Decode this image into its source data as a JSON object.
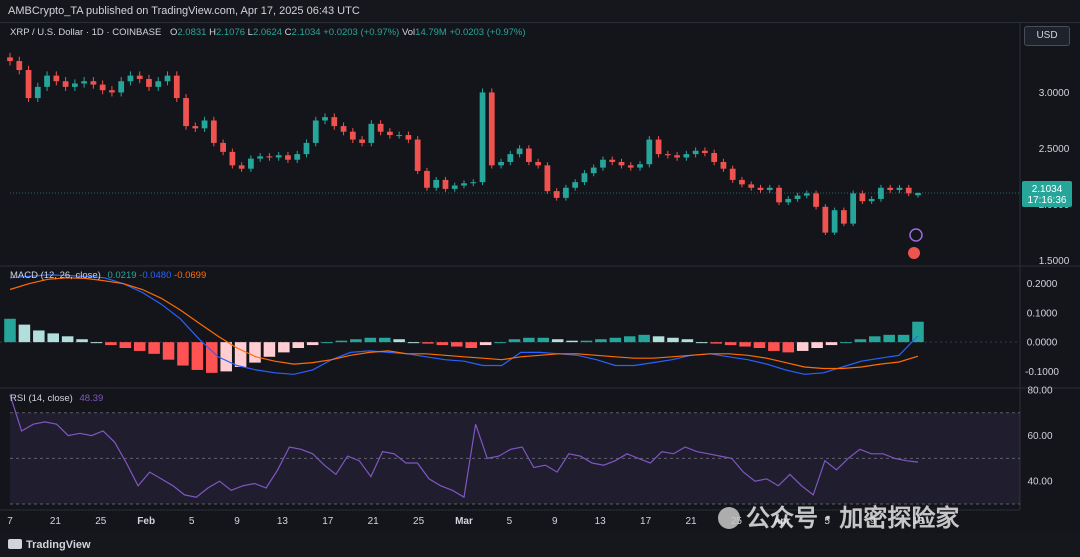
{
  "header": {
    "published": "AMBCrypto_TA published on TradingView.com, Apr 17, 2025 06:43 UTC",
    "currency_button": "USD"
  },
  "legend": {
    "symbol": "XRP / U.S. Dollar · 1D · COINBASE",
    "open_label": "O",
    "open": "2.0831",
    "high_label": "H",
    "high": "2.1076",
    "low_label": "L",
    "low": "2.0624",
    "close_label": "C",
    "close": "2.1034",
    "change": "+0.0203 (+0.97%)",
    "vol_label": "Vol",
    "vol": "14.79M",
    "vol_change": "+0.0203 (+0.97%)"
  },
  "macd_legend": {
    "label": "MACD (12, 26, close)",
    "macd": "0.0219",
    "signal": "-0.0480",
    "hist": "-0.0699"
  },
  "rsi_legend": {
    "label": "RSI (14, close)",
    "value": "48.39"
  },
  "price_tag": {
    "price": "2.1034",
    "countdown": "17:16:36"
  },
  "footer": {
    "brand": "TradingView"
  },
  "watermark": "公众号 · 加密探险家",
  "colors": {
    "up": "#26a69a",
    "down": "#ef5350",
    "macd": "#2962ff",
    "signal": "#ff6d00",
    "rsi": "#7e57c2",
    "bg": "#14151a"
  },
  "chart_data": [
    {
      "type": "candlestick",
      "title": "XRP / U.S. Dollar · 1D · COINBASE",
      "x_ticks": [
        "7",
        "21",
        "25",
        "Feb",
        "5",
        "9",
        "13",
        "17",
        "21",
        "25",
        "Mar",
        "5",
        "9",
        "13",
        "17",
        "21",
        "25",
        "Apr",
        "5",
        "9",
        "13"
      ],
      "y_ticks": [
        "3.0000",
        "2.5000",
        "2.0000",
        "1.5000"
      ],
      "ylim": [
        1.47,
        3.45
      ],
      "close_series": [
        3.28,
        3.2,
        2.95,
        3.05,
        3.15,
        3.1,
        3.05,
        3.08,
        3.1,
        3.07,
        3.02,
        3.0,
        3.1,
        3.15,
        3.12,
        3.05,
        3.1,
        3.15,
        2.95,
        2.7,
        2.68,
        2.75,
        2.55,
        2.47,
        2.35,
        2.32,
        2.41,
        2.43,
        2.42,
        2.44,
        2.4,
        2.45,
        2.55,
        2.75,
        2.78,
        2.7,
        2.65,
        2.58,
        2.55,
        2.72,
        2.65,
        2.62,
        2.62,
        2.58,
        2.3,
        2.15,
        2.22,
        2.14,
        2.17,
        2.19,
        2.2,
        3.0,
        2.35,
        2.38,
        2.45,
        2.5,
        2.38,
        2.35,
        2.12,
        2.06,
        2.15,
        2.2,
        2.28,
        2.33,
        2.4,
        2.38,
        2.35,
        2.33,
        2.36,
        2.58,
        2.45,
        2.44,
        2.42,
        2.45,
        2.48,
        2.46,
        2.38,
        2.32,
        2.22,
        2.18,
        2.15,
        2.13,
        2.15,
        2.02,
        2.05,
        2.08,
        2.1,
        1.98,
        1.75,
        1.95,
        1.83,
        2.1,
        2.03,
        2.05,
        2.15,
        2.13,
        2.15,
        2.1,
        2.1034
      ],
      "ohlc_latest": {
        "open": 2.0831,
        "high": 2.1076,
        "low": 2.0624,
        "close": 2.1034
      }
    },
    {
      "type": "line",
      "title": "MACD (12, 26, close)",
      "y_ticks": [
        "0.2000",
        "0.1000",
        "0.0000",
        "-0.1000"
      ],
      "ylim": [
        -0.15,
        0.24
      ],
      "series": [
        {
          "name": "MACD",
          "values": [
            0.22,
            0.225,
            0.23,
            0.228,
            0.225,
            0.22,
            0.2,
            0.17,
            0.13,
            0.08,
            0.01,
            -0.05,
            -0.08,
            -0.095,
            -0.105,
            -0.11,
            -0.095,
            -0.06,
            -0.035,
            -0.03,
            -0.035,
            -0.04,
            -0.05,
            -0.06,
            -0.065,
            -0.08,
            -0.08,
            -0.035,
            -0.035,
            -0.04,
            -0.045,
            -0.06,
            -0.08,
            -0.08,
            -0.07,
            -0.06,
            -0.045,
            -0.04,
            -0.05,
            -0.06,
            -0.075,
            -0.095,
            -0.11,
            -0.105,
            -0.085,
            -0.065,
            -0.055,
            -0.045,
            0.0219
          ]
        },
        {
          "name": "Signal",
          "values": [
            0.18,
            0.2,
            0.215,
            0.22,
            0.218,
            0.21,
            0.2,
            0.18,
            0.15,
            0.11,
            0.065,
            0.02,
            -0.02,
            -0.05,
            -0.065,
            -0.075,
            -0.07,
            -0.06,
            -0.045,
            -0.035,
            -0.03,
            -0.04,
            -0.04,
            -0.045,
            -0.05,
            -0.055,
            -0.06,
            -0.05,
            -0.045,
            -0.04,
            -0.04,
            -0.045,
            -0.05,
            -0.055,
            -0.055,
            -0.05,
            -0.045,
            -0.04,
            -0.04,
            -0.045,
            -0.055,
            -0.07,
            -0.085,
            -0.09,
            -0.09,
            -0.085,
            -0.075,
            -0.068,
            -0.048
          ]
        },
        {
          "name": "Histogram",
          "values": [
            0.08,
            0.06,
            0.04,
            0.03,
            0.02,
            0.01,
            0.0,
            -0.01,
            -0.02,
            -0.03,
            -0.04,
            -0.06,
            -0.08,
            -0.095,
            -0.105,
            -0.1,
            -0.085,
            -0.07,
            -0.05,
            -0.035,
            -0.02,
            -0.01,
            0.0,
            0.005,
            0.01,
            0.015,
            0.015,
            0.01,
            0.0,
            -0.005,
            -0.01,
            -0.015,
            -0.02,
            -0.01,
            0.0,
            0.01,
            0.015,
            0.015,
            0.01,
            0.005,
            0.005,
            0.01,
            0.015,
            0.02,
            0.025,
            0.02,
            0.015,
            0.01,
            0.0,
            -0.005,
            -0.01,
            -0.015,
            -0.02,
            -0.03,
            -0.035,
            -0.03,
            -0.02,
            -0.01,
            0.0,
            0.01,
            0.02,
            0.025,
            0.025,
            0.0699
          ]
        }
      ]
    },
    {
      "type": "line",
      "title": "RSI (14, close)",
      "y_ticks": [
        "80.00",
        "60.00",
        "40.00"
      ],
      "ylim": [
        30,
        80
      ],
      "bands": [
        70,
        50,
        30
      ],
      "series": [
        {
          "name": "RSI",
          "values": [
            78,
            62,
            65,
            66,
            65,
            60,
            61,
            60,
            62,
            57,
            48,
            38,
            44,
            41,
            38,
            34,
            33,
            37,
            40,
            36,
            38,
            39,
            37,
            45,
            55,
            54,
            52,
            47,
            43,
            51,
            49,
            42,
            53,
            52,
            48,
            48,
            41,
            38,
            36,
            33,
            65,
            50,
            51,
            54,
            55,
            46,
            47,
            44,
            52,
            51,
            48,
            47,
            49,
            52,
            50,
            48,
            53,
            52,
            55,
            53,
            52,
            51,
            50,
            44,
            40,
            41,
            38,
            43,
            38,
            34,
            49,
            45,
            50,
            54,
            52,
            52,
            50,
            49,
            48.39
          ]
        }
      ]
    }
  ]
}
